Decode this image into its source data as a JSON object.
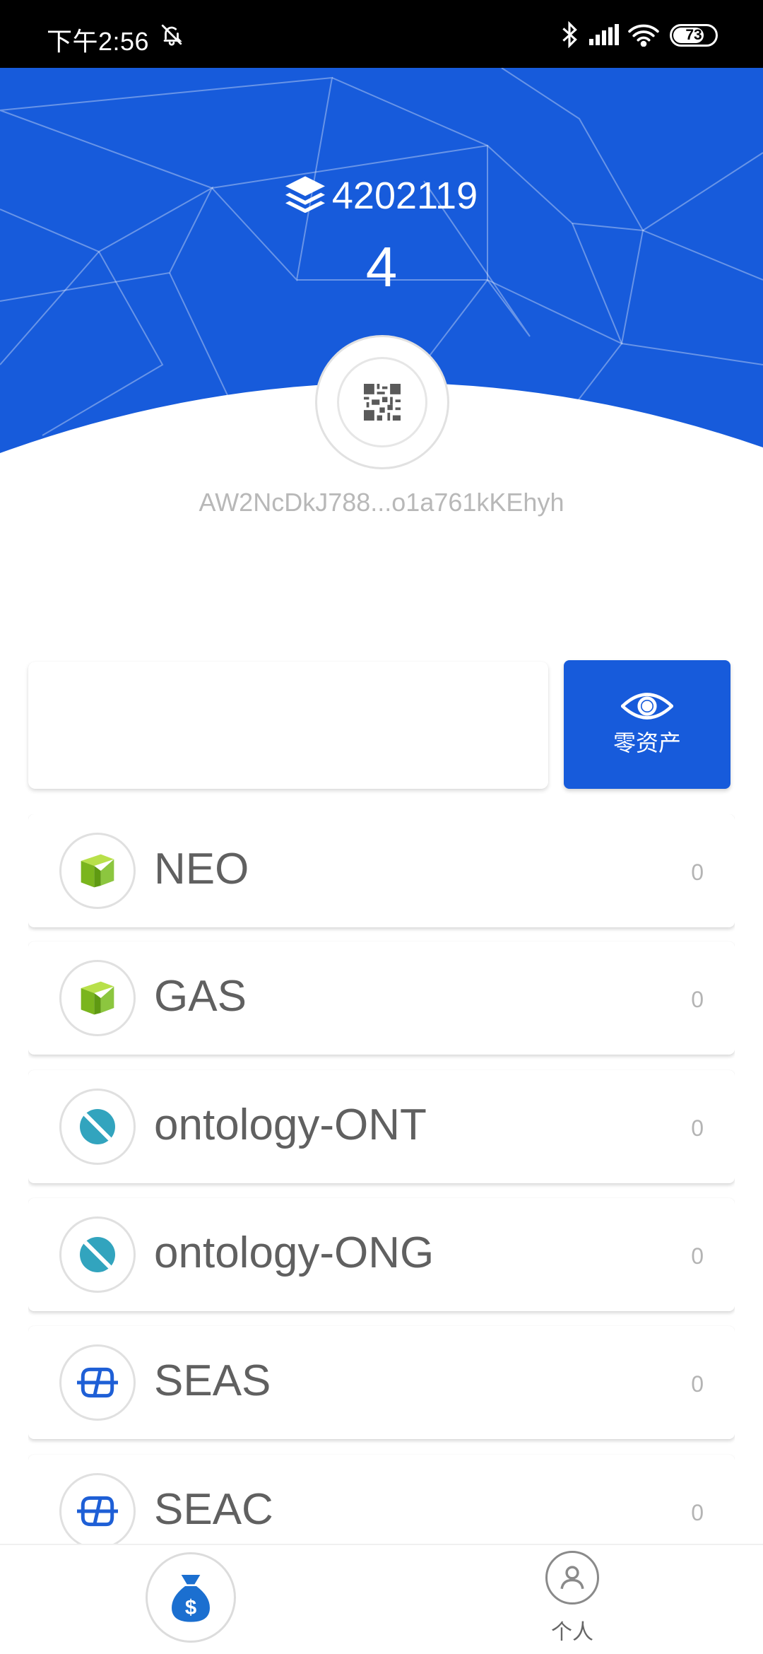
{
  "status_bar": {
    "time": "下午2:56",
    "battery": "73",
    "icons": [
      "bell-off-icon",
      "bluetooth-icon",
      "signal-icon",
      "wifi-icon",
      "battery-icon"
    ]
  },
  "header": {
    "block_height": "4202119",
    "count": "4",
    "address": "AW2NcDkJ788...o1a761kKEhyh",
    "accent_color": "#175bdb"
  },
  "search": {
    "value": "",
    "placeholder": ""
  },
  "zero_assets_toggle": {
    "label": "零资产",
    "icon": "eye-icon"
  },
  "assets": [
    {
      "name": "NEO",
      "balance": "0",
      "icon": "neo-icon"
    },
    {
      "name": "GAS",
      "balance": "0",
      "icon": "neo-icon"
    },
    {
      "name": "ontology-ONT",
      "balance": "0",
      "icon": "ontology-icon"
    },
    {
      "name": "ontology-ONG",
      "balance": "0",
      "icon": "ontology-icon"
    },
    {
      "name": "SEAS",
      "balance": "0",
      "icon": "sea-icon"
    },
    {
      "name": "SEAC",
      "balance": "0",
      "icon": "sea-icon"
    }
  ],
  "bottom_nav": {
    "wallet_icon": "money-bag-icon",
    "me_label": "个人"
  }
}
